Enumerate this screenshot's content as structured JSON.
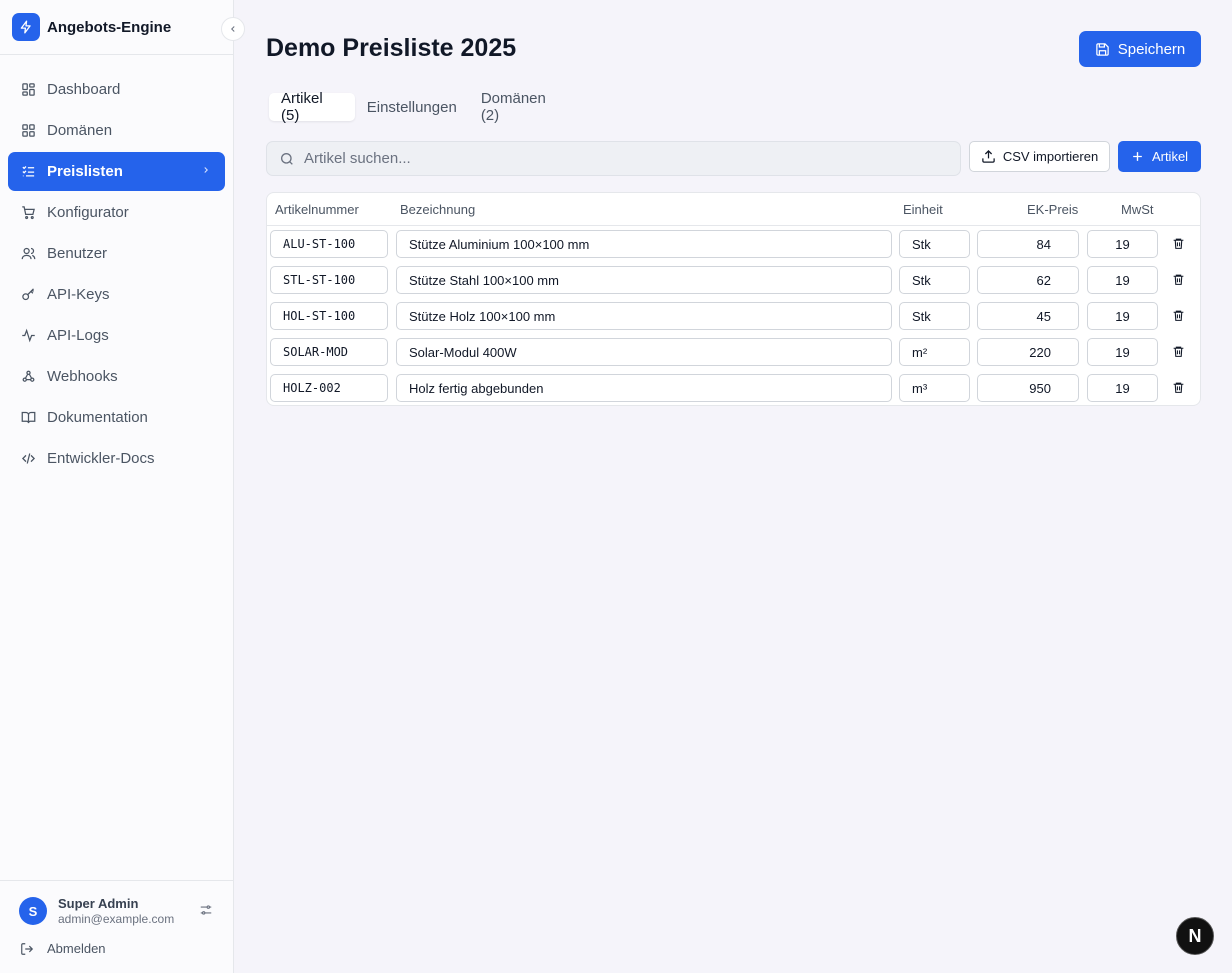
{
  "app": {
    "name": "Angebots-Engine"
  },
  "sidebar": {
    "items": [
      {
        "label": "Dashboard",
        "icon": "dashboard-icon"
      },
      {
        "label": "Domänen",
        "icon": "grid-icon"
      },
      {
        "label": "Preislisten",
        "icon": "list-check-icon",
        "active": true
      },
      {
        "label": "Konfigurator",
        "icon": "cart-icon"
      },
      {
        "label": "Benutzer",
        "icon": "users-icon"
      },
      {
        "label": "API-Keys",
        "icon": "key-icon"
      },
      {
        "label": "API-Logs",
        "icon": "activity-icon"
      },
      {
        "label": "Webhooks",
        "icon": "webhook-icon"
      },
      {
        "label": "Dokumentation",
        "icon": "book-icon"
      },
      {
        "label": "Entwickler-Docs",
        "icon": "code-icon"
      }
    ],
    "user": {
      "initial": "S",
      "name": "Super Admin",
      "email": "admin@example.com"
    },
    "logout_label": "Abmelden"
  },
  "main": {
    "title": "Demo Preisliste 2025",
    "save_label": "Speichern",
    "tabs": [
      {
        "label": "Artikel (5)",
        "active": true
      },
      {
        "label": "Einstellungen"
      },
      {
        "label": "Domänen (2)"
      }
    ],
    "search": {
      "placeholder": "Artikel suchen..."
    },
    "csv_label": "CSV importieren",
    "add_label": "Artikel",
    "table": {
      "headers": [
        "Artikelnummer",
        "Bezeichnung",
        "Einheit",
        "EK-Preis",
        "MwSt"
      ],
      "rows": [
        {
          "sku": "ALU-ST-100",
          "name": "Stütze Aluminium 100×100 mm",
          "unit": "Stk",
          "price": "84",
          "vat": "19"
        },
        {
          "sku": "STL-ST-100",
          "name": "Stütze Stahl 100×100 mm",
          "unit": "Stk",
          "price": "62",
          "vat": "19"
        },
        {
          "sku": "HOL-ST-100",
          "name": "Stütze Holz 100×100 mm",
          "unit": "Stk",
          "price": "45",
          "vat": "19"
        },
        {
          "sku": "SOLAR-MOD",
          "name": "Solar-Modul 400W",
          "unit": "m²",
          "price": "220",
          "vat": "19"
        },
        {
          "sku": "HOLZ-002",
          "name": "Holz fertig abgebunden",
          "unit": "m³",
          "price": "950",
          "vat": "19"
        }
      ]
    }
  },
  "badge": {
    "letter": "N"
  },
  "colors": {
    "accent": "#2563eb",
    "background": "#f5f4fa"
  }
}
